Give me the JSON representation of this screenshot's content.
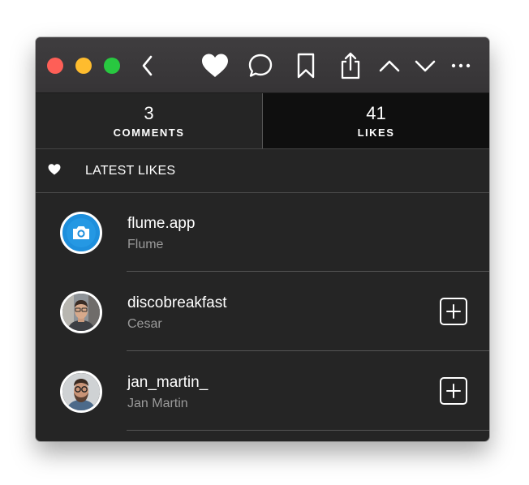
{
  "toolbar": {
    "icons": [
      "back-icon",
      "heart-icon",
      "comment-icon",
      "bookmark-icon",
      "share-icon",
      "chevron-up-icon",
      "chevron-down-icon",
      "more-icon"
    ]
  },
  "tabs": {
    "comments": {
      "count": "3",
      "label": "COMMENTS"
    },
    "likes": {
      "count": "41",
      "label": "LIKES",
      "selected": true
    }
  },
  "section": {
    "title": "LATEST LIKES",
    "icon": "heart-icon"
  },
  "likes": [
    {
      "username": "flume.app",
      "name": "Flume",
      "has_follow": false
    },
    {
      "username": "discobreakfast",
      "name": "Cesar",
      "has_follow": true
    },
    {
      "username": "jan_martin_",
      "name": "Jan Martin",
      "has_follow": true
    }
  ],
  "colors": {
    "window_bg": "#252525",
    "titlebar": "#3a383a",
    "selected_tab": "#0f0f0f",
    "secondary_text": "#9a9a9a",
    "traffic_red": "#fe5f57",
    "traffic_yellow": "#febc2e",
    "traffic_green": "#28c840",
    "flume_blue": "#1e8fdc"
  }
}
